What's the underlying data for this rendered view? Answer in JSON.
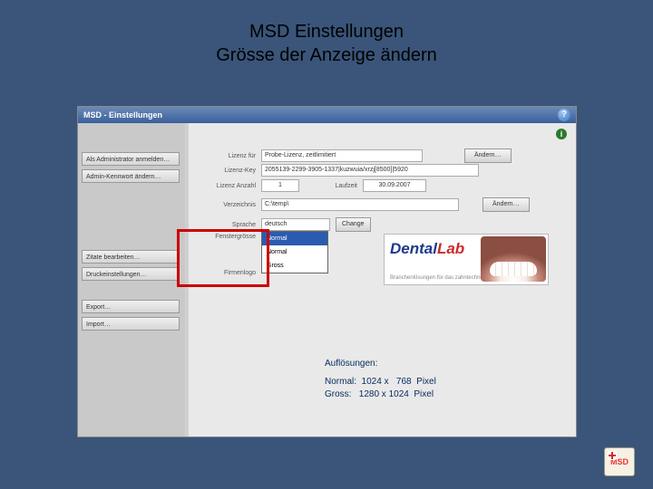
{
  "slide": {
    "title_line1": "MSD Einstellungen",
    "title_line2": "Grösse der Anzeige ändern"
  },
  "app": {
    "window_title": "MSD - Einstellungen",
    "header_right": "",
    "help_icon_label": "?"
  },
  "sidebar": {
    "btn1": "Als Administrator anmelden…",
    "btn2": "Admin-Kennwort ändern…",
    "btn3": "Zitate bearbeiten…",
    "btn4": "Druckeinstellungen…",
    "btn5": "Export…",
    "btn6": "Import…"
  },
  "form": {
    "license_for_label": "Lizenz für",
    "license_for_value": "Probe-Lizenz, zeitlimitiert",
    "license_key_label": "Lizenz-Key",
    "license_key_value": "2055139-2299-3905-1337|kuzwuia/xrzj[8500]|5920",
    "license_count_label": "Lizenz Anzahl",
    "license_count_value": "1",
    "runtime_label": "Laufzeit",
    "runtime_value": "30.09.2007",
    "directory_label": "Verzeichnis",
    "directory_value": "C:\\temp\\",
    "language_label": "Sprache",
    "language_value": "deutsch",
    "window_size_label": "Fenstergrösse",
    "company_label": "Firmenlogo",
    "change_btn": "Ändern…",
    "change_lang_btn": "Change"
  },
  "dropdown": {
    "opt1": "Normal",
    "opt2": "Normal",
    "opt3": "Gross"
  },
  "logo": {
    "brand_prefix": "Dental",
    "brand_suffix": "Lab",
    "subtitle": "Branchenlösungen für das zahntechnische Labor"
  },
  "resolutions": {
    "header": "Auflösungen:",
    "normal": "Normal:  1024 x   768  Pixel",
    "gross": "Gross:   1280 x 1024  Pixel"
  },
  "info_icon": "i"
}
